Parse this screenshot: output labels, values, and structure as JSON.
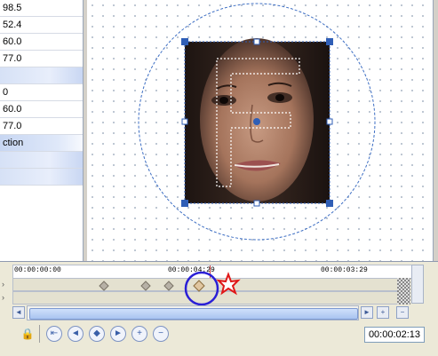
{
  "properties": {
    "rows": [
      {
        "value": "98.5"
      },
      {
        "value": "52.4"
      },
      {
        "value": "60.0"
      },
      {
        "value": "77.0"
      },
      {
        "value": ""
      },
      {
        "value": "0"
      },
      {
        "value": "60.0"
      },
      {
        "value": "77.0"
      },
      {
        "value": "ction"
      },
      {
        "value": ""
      },
      {
        "value": ""
      }
    ]
  },
  "timeline": {
    "ruler_labels": [
      "00:00:00:00",
      "00:00:04:29",
      "00:00:03:29"
    ],
    "current_time": "00:00:02:13"
  },
  "toolbar": {
    "buttons": [
      {
        "name": "lock-keyframes-button",
        "glyph": "🔒"
      },
      {
        "name": "first-keyframe-button",
        "glyph": "⇤"
      },
      {
        "name": "prev-keyframe-button",
        "glyph": "◄"
      },
      {
        "name": "add-keyframe-button",
        "glyph": "◆"
      },
      {
        "name": "next-keyframe-button",
        "glyph": "►"
      },
      {
        "name": "add-button",
        "glyph": "+"
      },
      {
        "name": "remove-button",
        "glyph": "−"
      }
    ]
  },
  "colors": {
    "selection_handle": "#2f5eb6",
    "circle_guide": "#3e6fc4",
    "highlight_circle": "#2a1fd6",
    "star_marker": "#e01818"
  }
}
